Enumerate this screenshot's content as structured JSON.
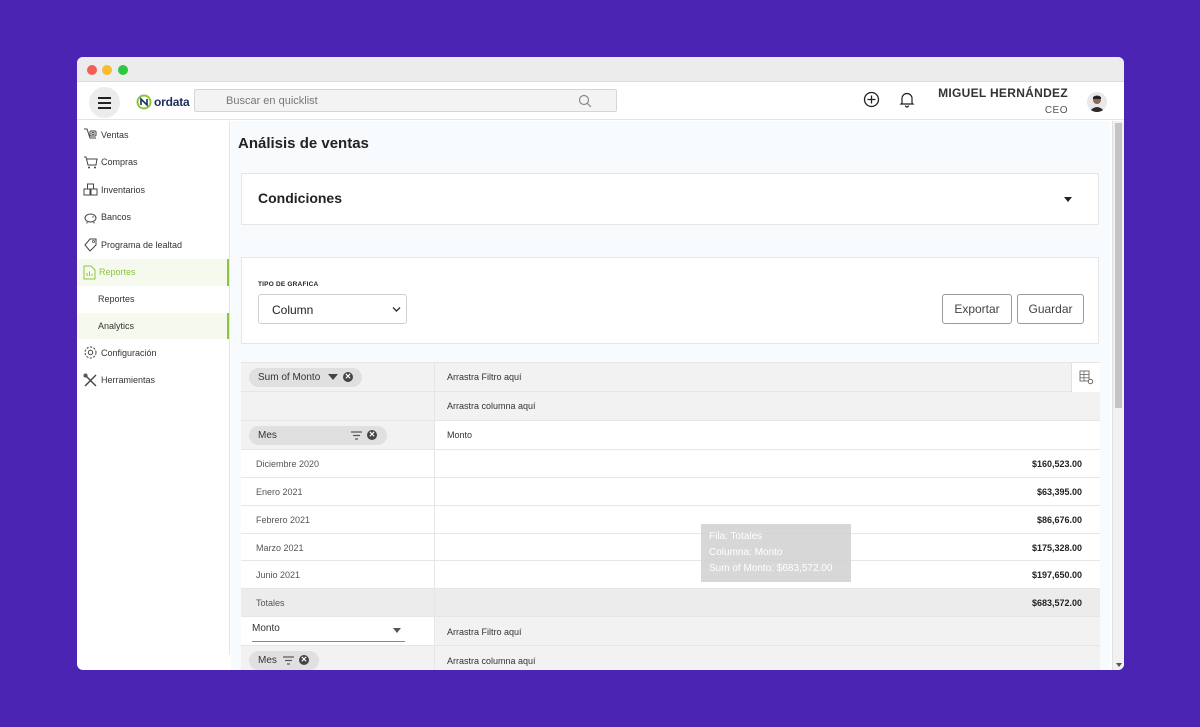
{
  "header": {
    "brand": "ordata",
    "search_placeholder": "Buscar en quicklist",
    "user_name": "MIGUEL HERNÁNDEZ",
    "user_role": "CEO"
  },
  "sidebar": {
    "items": [
      {
        "label": "Ventas",
        "icon": "sales-icon"
      },
      {
        "label": "Compras",
        "icon": "cart-icon"
      },
      {
        "label": "Inventarios",
        "icon": "boxes-icon"
      },
      {
        "label": "Bancos",
        "icon": "piggy-bank-icon"
      },
      {
        "label": "Programa de lealtad",
        "icon": "loyalty-icon"
      },
      {
        "label": "Reportes",
        "icon": "report-icon",
        "active": true
      },
      {
        "label": "Configuración",
        "icon": "gear-icon"
      },
      {
        "label": "Herramientas",
        "icon": "tools-icon"
      }
    ],
    "sub_items": [
      "Reportes",
      "Analytics"
    ],
    "active_color": "#8bc53f"
  },
  "page": {
    "title": "Análisis de ventas",
    "conditions_title": "Condiciones",
    "chart_type_label": "TIPO DE GRAFICA",
    "chart_type_value": "Column",
    "export_label": "Exportar",
    "save_label": "Guardar"
  },
  "pivot": {
    "value_chip": "Sum of Monto",
    "filter_drop": "Arrastra Filtro aquí",
    "column_drop": "Arrastra columna aquí",
    "row_chip": "Mes",
    "column_header": "Monto",
    "rows": [
      {
        "label": "Diciembre 2020",
        "value": "$160,523.00"
      },
      {
        "label": "Enero 2021",
        "value": "$63,395.00"
      },
      {
        "label": "Febrero 2021",
        "value": "$86,676.00"
      },
      {
        "label": "Marzo 2021",
        "value": "$175,328.00"
      },
      {
        "label": "Junio 2021",
        "value": "$197,650.00"
      }
    ],
    "totals_label": "Totales",
    "totals_value": "$683,572.00",
    "tooltip": {
      "row": "Fila: Totales",
      "column": "Columna: Monto",
      "sum": "Sum of Monto: $683,572.00"
    },
    "measure_select": "Monto",
    "filter_drop_2": "Arrastra Filtro aquí",
    "row_chip_2": "Mes",
    "column_drop_2": "Arrastra columna aquí"
  }
}
